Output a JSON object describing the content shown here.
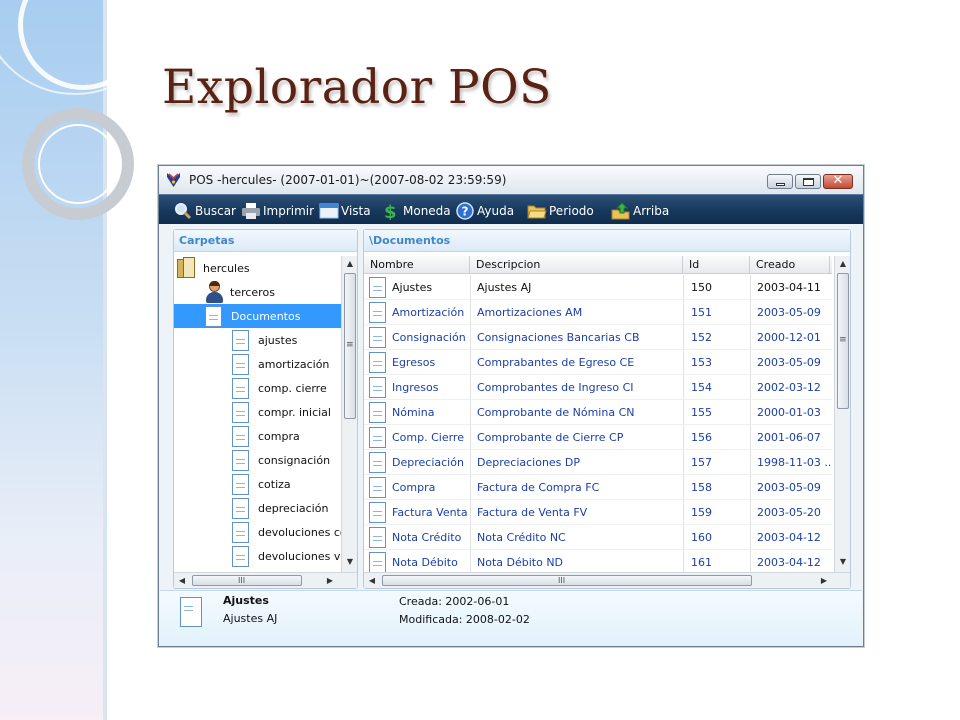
{
  "slide": {
    "title": "Explorador POS"
  },
  "window": {
    "title": "POS -hercules- (2007-01-01)~(2007-08-02 23:59:59)",
    "close_glyph": "✕"
  },
  "toolbar": {
    "buttons": [
      {
        "label": "Buscar",
        "icon": "search-icon"
      },
      {
        "label": "Imprimir",
        "icon": "printer-icon"
      },
      {
        "label": "Vista",
        "icon": "window-view-icon"
      },
      {
        "label": "Moneda",
        "icon": "dollar-icon"
      },
      {
        "label": "Ayuda",
        "icon": "help-icon"
      },
      {
        "label": "Periodo",
        "icon": "folder-open-icon"
      },
      {
        "label": "Arriba",
        "icon": "up-arrow-icon"
      }
    ]
  },
  "folders": {
    "header": "Carpetas",
    "items": [
      {
        "label": "hercules",
        "icon": "folder-icon",
        "indent": 0
      },
      {
        "label": "terceros",
        "icon": "user-icon",
        "indent": 1
      },
      {
        "label": "Documentos",
        "icon": "document-icon",
        "indent": 1,
        "selected": true
      },
      {
        "label": "ajustes",
        "icon": "document-icon",
        "indent": 2
      },
      {
        "label": "amortización",
        "icon": "document-icon",
        "indent": 2
      },
      {
        "label": "comp. cierre",
        "icon": "document-icon",
        "indent": 2
      },
      {
        "label": "compr. inicial",
        "icon": "document-icon",
        "indent": 2
      },
      {
        "label": "compra",
        "icon": "document-icon",
        "indent": 2
      },
      {
        "label": "consignación",
        "icon": "document-icon",
        "indent": 2
      },
      {
        "label": "cotiza",
        "icon": "document-icon",
        "indent": 2
      },
      {
        "label": "depreciación",
        "icon": "document-icon",
        "indent": 2
      },
      {
        "label": "devoluciones co",
        "icon": "document-icon",
        "indent": 2
      },
      {
        "label": "devoluciones ve",
        "icon": "document-icon",
        "indent": 2
      }
    ]
  },
  "documents": {
    "header": "\\Documentos",
    "columns": [
      "Nombre",
      "Descripcion",
      "Id",
      "Creado"
    ],
    "rows": [
      [
        "Ajustes",
        "Ajustes AJ",
        "150",
        "2003-04-11"
      ],
      [
        "Amortización",
        "Amortizaciones AM",
        "151",
        "2003-05-09"
      ],
      [
        "Consignación",
        "Consignaciones Bancarias CB",
        "152",
        "2000-12-01"
      ],
      [
        "Egresos",
        "Comprabantes de Egreso CE",
        "153",
        "2003-05-09"
      ],
      [
        "Ingresos",
        "Comprobantes de Ingreso CI",
        "154",
        "2002-03-12"
      ],
      [
        "Nómina",
        "Comprobante de Nómina CN",
        "155",
        "2000-01-03"
      ],
      [
        "Comp. Cierre",
        "Comprobante de Cierre CP",
        "156",
        "2001-06-07"
      ],
      [
        "Depreciación",
        "Depreciaciones DP",
        "157",
        "1998-11-03 ..."
      ],
      [
        "Compra",
        "Factura de Compra FC",
        "158",
        "2003-05-09"
      ],
      [
        "Factura Venta",
        "Factura de Venta FV",
        "159",
        "2003-05-20"
      ],
      [
        "Nota Crédito",
        "Nota Crédito NC",
        "160",
        "2003-04-12"
      ],
      [
        "Nota Débito",
        "Nota Débito ND",
        "161",
        "2003-04-12"
      ]
    ]
  },
  "details": {
    "name": "Ajustes",
    "description": "Ajustes AJ",
    "created": "Creada: 2002-06-01",
    "modified": "Modificada: 2008-02-02"
  },
  "scroll": {
    "up": "▲",
    "down": "▼",
    "left": "◀",
    "right": "▶",
    "grip_v": "≡",
    "grip_h": "III"
  },
  "colors": {
    "toolbar_bg": "#17385c",
    "selection": "#3399ff",
    "link_text": "#1b3fa6",
    "panel_header_text": "#3f87c9",
    "title_text": "#5a2212"
  }
}
